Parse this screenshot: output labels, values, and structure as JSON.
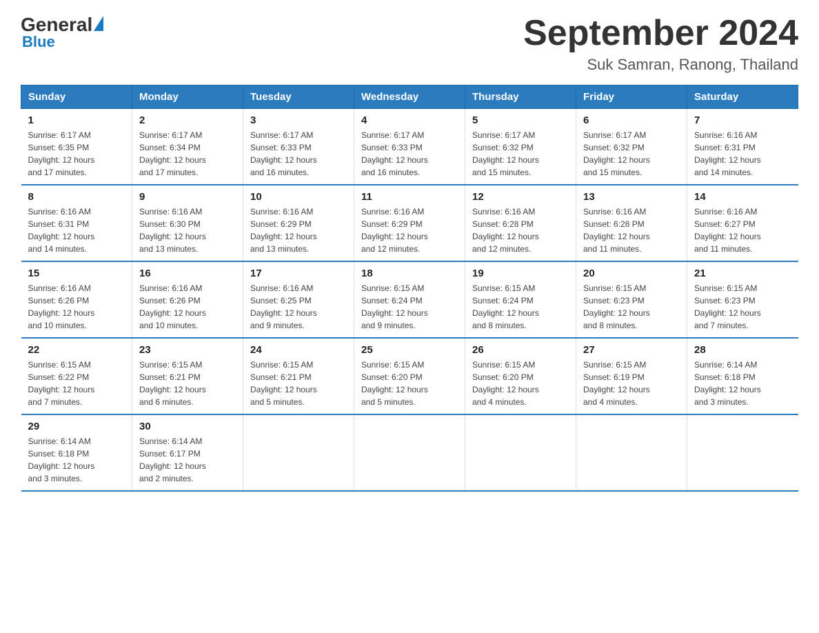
{
  "header": {
    "logo_general": "General",
    "logo_blue": "Blue",
    "title": "September 2024",
    "subtitle": "Suk Samran, Ranong, Thailand"
  },
  "days_of_week": [
    "Sunday",
    "Monday",
    "Tuesday",
    "Wednesday",
    "Thursday",
    "Friday",
    "Saturday"
  ],
  "weeks": [
    [
      {
        "day": "1",
        "sunrise": "6:17 AM",
        "sunset": "6:35 PM",
        "daylight": "12 hours and 17 minutes."
      },
      {
        "day": "2",
        "sunrise": "6:17 AM",
        "sunset": "6:34 PM",
        "daylight": "12 hours and 17 minutes."
      },
      {
        "day": "3",
        "sunrise": "6:17 AM",
        "sunset": "6:33 PM",
        "daylight": "12 hours and 16 minutes."
      },
      {
        "day": "4",
        "sunrise": "6:17 AM",
        "sunset": "6:33 PM",
        "daylight": "12 hours and 16 minutes."
      },
      {
        "day": "5",
        "sunrise": "6:17 AM",
        "sunset": "6:32 PM",
        "daylight": "12 hours and 15 minutes."
      },
      {
        "day": "6",
        "sunrise": "6:17 AM",
        "sunset": "6:32 PM",
        "daylight": "12 hours and 15 minutes."
      },
      {
        "day": "7",
        "sunrise": "6:16 AM",
        "sunset": "6:31 PM",
        "daylight": "12 hours and 14 minutes."
      }
    ],
    [
      {
        "day": "8",
        "sunrise": "6:16 AM",
        "sunset": "6:31 PM",
        "daylight": "12 hours and 14 minutes."
      },
      {
        "day": "9",
        "sunrise": "6:16 AM",
        "sunset": "6:30 PM",
        "daylight": "12 hours and 13 minutes."
      },
      {
        "day": "10",
        "sunrise": "6:16 AM",
        "sunset": "6:29 PM",
        "daylight": "12 hours and 13 minutes."
      },
      {
        "day": "11",
        "sunrise": "6:16 AM",
        "sunset": "6:29 PM",
        "daylight": "12 hours and 12 minutes."
      },
      {
        "day": "12",
        "sunrise": "6:16 AM",
        "sunset": "6:28 PM",
        "daylight": "12 hours and 12 minutes."
      },
      {
        "day": "13",
        "sunrise": "6:16 AM",
        "sunset": "6:28 PM",
        "daylight": "12 hours and 11 minutes."
      },
      {
        "day": "14",
        "sunrise": "6:16 AM",
        "sunset": "6:27 PM",
        "daylight": "12 hours and 11 minutes."
      }
    ],
    [
      {
        "day": "15",
        "sunrise": "6:16 AM",
        "sunset": "6:26 PM",
        "daylight": "12 hours and 10 minutes."
      },
      {
        "day": "16",
        "sunrise": "6:16 AM",
        "sunset": "6:26 PM",
        "daylight": "12 hours and 10 minutes."
      },
      {
        "day": "17",
        "sunrise": "6:16 AM",
        "sunset": "6:25 PM",
        "daylight": "12 hours and 9 minutes."
      },
      {
        "day": "18",
        "sunrise": "6:15 AM",
        "sunset": "6:24 PM",
        "daylight": "12 hours and 9 minutes."
      },
      {
        "day": "19",
        "sunrise": "6:15 AM",
        "sunset": "6:24 PM",
        "daylight": "12 hours and 8 minutes."
      },
      {
        "day": "20",
        "sunrise": "6:15 AM",
        "sunset": "6:23 PM",
        "daylight": "12 hours and 8 minutes."
      },
      {
        "day": "21",
        "sunrise": "6:15 AM",
        "sunset": "6:23 PM",
        "daylight": "12 hours and 7 minutes."
      }
    ],
    [
      {
        "day": "22",
        "sunrise": "6:15 AM",
        "sunset": "6:22 PM",
        "daylight": "12 hours and 7 minutes."
      },
      {
        "day": "23",
        "sunrise": "6:15 AM",
        "sunset": "6:21 PM",
        "daylight": "12 hours and 6 minutes."
      },
      {
        "day": "24",
        "sunrise": "6:15 AM",
        "sunset": "6:21 PM",
        "daylight": "12 hours and 5 minutes."
      },
      {
        "day": "25",
        "sunrise": "6:15 AM",
        "sunset": "6:20 PM",
        "daylight": "12 hours and 5 minutes."
      },
      {
        "day": "26",
        "sunrise": "6:15 AM",
        "sunset": "6:20 PM",
        "daylight": "12 hours and 4 minutes."
      },
      {
        "day": "27",
        "sunrise": "6:15 AM",
        "sunset": "6:19 PM",
        "daylight": "12 hours and 4 minutes."
      },
      {
        "day": "28",
        "sunrise": "6:14 AM",
        "sunset": "6:18 PM",
        "daylight": "12 hours and 3 minutes."
      }
    ],
    [
      {
        "day": "29",
        "sunrise": "6:14 AM",
        "sunset": "6:18 PM",
        "daylight": "12 hours and 3 minutes."
      },
      {
        "day": "30",
        "sunrise": "6:14 AM",
        "sunset": "6:17 PM",
        "daylight": "12 hours and 2 minutes."
      },
      null,
      null,
      null,
      null,
      null
    ]
  ],
  "labels": {
    "sunrise": "Sunrise:",
    "sunset": "Sunset:",
    "daylight": "Daylight:"
  }
}
